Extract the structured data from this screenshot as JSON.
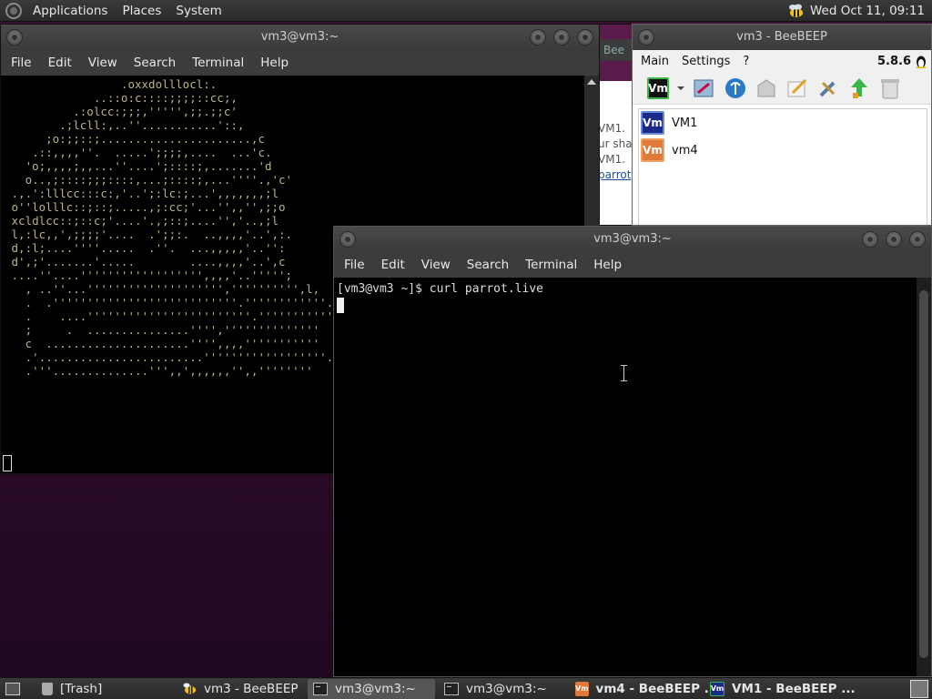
{
  "top_panel": {
    "menus": [
      "Applications",
      "Places",
      "System"
    ],
    "clock": "Wed Oct 11, 09:11"
  },
  "terminal_back": {
    "title": "vm3@vm3:~",
    "menu": [
      "File",
      "Edit",
      "View",
      "Search",
      "Terminal",
      "Help"
    ],
    "ascii_lines": [
      "                 .oxxdolllocl:.",
      "             ..::o:c::::;;;;::cc;,",
      "          .:olcc:;;;,''''',;;.;;c'",
      "        .;lcll:,..''...........'::,",
      "      ;o:;;::;......................,c",
      "    .::,,,,''.  .....';;;;,....  ...'c.",
      "   'o;,,,,;,,...''....';::::;,.......'d",
      "   o..,;::::;;;::::,...;::::;,...''''.,'c'",
      " .,.':lllcc:::c:,'..';:lc:;...',,,,,,,;l",
      " o''lolllc::;::;.....,;:cc;'...'',,'',;;o",
      " xcldlcc::;::c;'....'.,;::;....'','..,;l",
      " l,:lc,,',;;;;'....  .';;:.  ..,,,,'..',:.",
      " d,:l;....''''.....  .''.  ...,,,,,'..'':",
      " d',;'.......'.....        ....,,,,'..',c",
      " ....''....'''''''''''''''''',,,,'..''''';",
      "   , ..''...'''''''''''''''''''','''''''''',l,",
      "   .  .'''''''''''''''''''''''''''.''''''''''''.",
      "   .    ....''''''''''''''''''''''''.''''''''''''",
      "   ;     .  ...............'''',''''''''''''''",
      "   c  .....................'''',,,,'''''''''''",
      "   .'........................''''''''''''''''''.",
      "   .'''..............''',,',,,,,,'',,''''''''"
    ]
  },
  "beebeep": {
    "title": "vm3 - BeeBEEP",
    "menu": [
      "Main",
      "Settings",
      "?"
    ],
    "version": "5.8.6",
    "users": [
      {
        "badge": "Vm",
        "name": "VM1",
        "color": "#1b2a8a"
      },
      {
        "badge": "Vm",
        "name": "vm4",
        "color": "#e07a3a"
      }
    ]
  },
  "browser": {
    "tab_label": "Bee",
    "lines": [
      "VM1.",
      "ur shar",
      "VM1."
    ],
    "link": "parrot"
  },
  "terminal_front": {
    "title": "vm3@vm3:~",
    "menu": [
      "File",
      "Edit",
      "View",
      "Search",
      "Terminal",
      "Help"
    ],
    "prompt": "[vm3@vm3 ~]$ curl parrot.live"
  },
  "taskbar": {
    "items": [
      {
        "label": "[Trash]",
        "icon": "trash-icon",
        "active": false,
        "bold": false
      },
      {
        "label": "vm3 - BeeBEEP",
        "icon": "bee-icon",
        "active": false,
        "bold": false
      },
      {
        "label": "vm3@vm3:~",
        "icon": "terminal-icon",
        "active": true,
        "bold": false
      },
      {
        "label": "vm3@vm3:~",
        "icon": "terminal-icon",
        "active": false,
        "bold": false
      },
      {
        "label": "vm4 - BeeBEEP ...",
        "icon": "vm4-icon",
        "active": false,
        "bold": true
      },
      {
        "label": "VM1 - BeeBEEP ...",
        "icon": "vm1-icon",
        "active": false,
        "bold": true
      }
    ]
  }
}
